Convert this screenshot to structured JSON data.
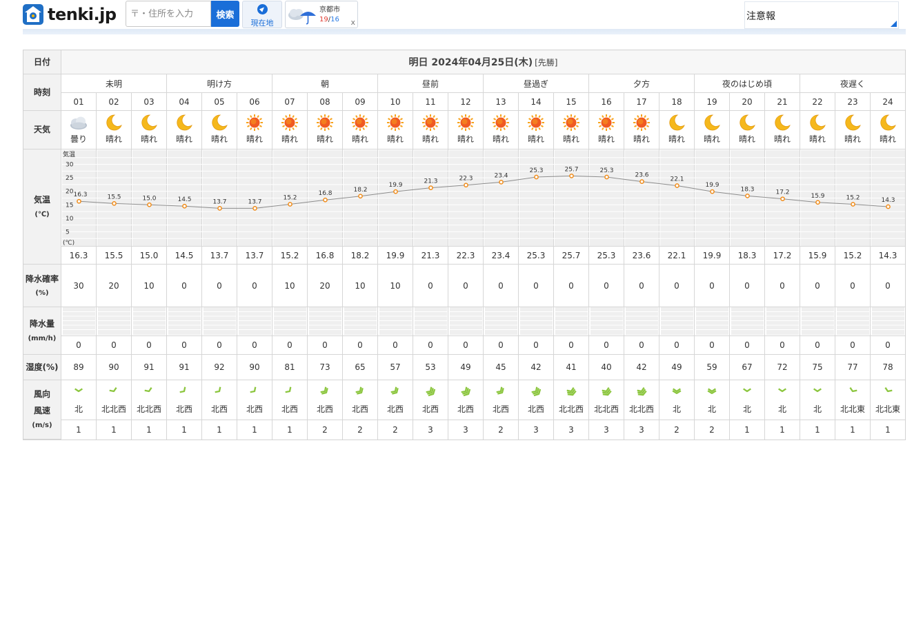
{
  "header": {
    "logo_text": "tenki.jp",
    "search_placeholder": "〒・住所を入力",
    "search_button": "検索",
    "location_button": "現在地",
    "recent": {
      "city": "京都市",
      "high": "19",
      "separator": "/",
      "low": "16",
      "close": "x"
    },
    "alert_label": "注意報"
  },
  "table": {
    "labels": {
      "date": "日付",
      "time": "時刻",
      "weather": "天気",
      "temp": "気温",
      "temp_unit": "(℃)",
      "precip_prob": "降水確率",
      "precip_prob_unit": "(%)",
      "precip_amount": "降水量",
      "precip_amount_unit": "(mm/h)",
      "humidity": "湿度(%)",
      "wind_dir": "風向",
      "wind_speed": "風速",
      "wind_unit": "(m/s)"
    },
    "date_title": "明日 2024年04月25日(木)",
    "date_tag": "[先勝]",
    "periods": [
      "未明",
      "明け方",
      "朝",
      "昼前",
      "昼過ぎ",
      "夕方",
      "夜のはじめ頃",
      "夜遅く"
    ],
    "hours": [
      "01",
      "02",
      "03",
      "04",
      "05",
      "06",
      "07",
      "08",
      "09",
      "10",
      "11",
      "12",
      "13",
      "14",
      "15",
      "16",
      "17",
      "18",
      "19",
      "20",
      "21",
      "22",
      "23",
      "24"
    ],
    "weather": [
      "曇り",
      "晴れ",
      "晴れ",
      "晴れ",
      "晴れ",
      "晴れ",
      "晴れ",
      "晴れ",
      "晴れ",
      "晴れ",
      "晴れ",
      "晴れ",
      "晴れ",
      "晴れ",
      "晴れ",
      "晴れ",
      "晴れ",
      "晴れ",
      "晴れ",
      "晴れ",
      "晴れ",
      "晴れ",
      "晴れ",
      "晴れ"
    ],
    "weather_icons": [
      "cloud-icon",
      "moon-icon",
      "moon-icon",
      "moon-icon",
      "moon-icon",
      "sun-icon",
      "sun-icon",
      "sun-icon",
      "sun-icon",
      "sun-icon",
      "sun-icon",
      "sun-icon",
      "sun-icon",
      "sun-icon",
      "sun-icon",
      "sun-icon",
      "sun-icon",
      "moon-icon",
      "moon-icon",
      "moon-icon",
      "moon-icon",
      "moon-icon",
      "moon-icon",
      "moon-icon"
    ],
    "temps": [
      "16.3",
      "15.5",
      "15.0",
      "14.5",
      "13.7",
      "13.7",
      "15.2",
      "16.8",
      "18.2",
      "19.9",
      "21.3",
      "22.3",
      "23.4",
      "25.3",
      "25.7",
      "25.3",
      "23.6",
      "22.1",
      "19.9",
      "18.3",
      "17.2",
      "15.9",
      "15.2",
      "14.3"
    ],
    "precip_prob": [
      "30",
      "20",
      "10",
      "0",
      "0",
      "0",
      "10",
      "20",
      "10",
      "10",
      "0",
      "0",
      "0",
      "0",
      "0",
      "0",
      "0",
      "0",
      "0",
      "0",
      "0",
      "0",
      "0",
      "0"
    ],
    "precip_amount": [
      "0",
      "0",
      "0",
      "0",
      "0",
      "0",
      "0",
      "0",
      "0",
      "0",
      "0",
      "0",
      "0",
      "0",
      "0",
      "0",
      "0",
      "0",
      "0",
      "0",
      "0",
      "0",
      "0",
      "0"
    ],
    "humidity": [
      "89",
      "90",
      "91",
      "91",
      "92",
      "90",
      "81",
      "73",
      "65",
      "57",
      "53",
      "49",
      "45",
      "42",
      "41",
      "40",
      "42",
      "49",
      "59",
      "67",
      "72",
      "75",
      "77",
      "78"
    ],
    "wind_dir": [
      "北",
      "北北西",
      "北北西",
      "北西",
      "北西",
      "北西",
      "北西",
      "北西",
      "北西",
      "北西",
      "北西",
      "北西",
      "北西",
      "北西",
      "北北西",
      "北北西",
      "北北西",
      "北",
      "北",
      "北",
      "北",
      "北",
      "北北東",
      "北北東"
    ],
    "wind_speed": [
      "1",
      "1",
      "1",
      "1",
      "1",
      "1",
      "1",
      "2",
      "2",
      "2",
      "3",
      "3",
      "2",
      "3",
      "3",
      "3",
      "3",
      "2",
      "2",
      "1",
      "1",
      "1",
      "1",
      "1"
    ],
    "wind_icon": "wind-arrow-icon"
  },
  "chart_data": {
    "type": "line",
    "x": [
      "01",
      "02",
      "03",
      "04",
      "05",
      "06",
      "07",
      "08",
      "09",
      "10",
      "11",
      "12",
      "13",
      "14",
      "15",
      "16",
      "17",
      "18",
      "19",
      "20",
      "21",
      "22",
      "23",
      "24"
    ],
    "series": [
      {
        "values": [
          16.3,
          15.5,
          15.0,
          14.5,
          13.7,
          13.7,
          15.2,
          16.8,
          18.2,
          19.9,
          21.3,
          22.3,
          23.4,
          25.3,
          25.7,
          25.3,
          23.6,
          22.1,
          19.9,
          18.3,
          17.2,
          15.9,
          15.2,
          14.3
        ]
      }
    ],
    "ylabel": "気温",
    "yunit": "(℃)",
    "ylim": [
      0,
      35
    ],
    "yticks": [
      5,
      10,
      15,
      20,
      25,
      30
    ],
    "grid": true,
    "line_color": "#8c8c8c",
    "marker_color": "#f08c1a"
  },
  "colors": {
    "label_bg": "#f2f2f2",
    "border": "#d6d6d6",
    "accent": "#1a6ed8",
    "chart_cell_bg": "#efefef",
    "wind_icon": "#8cc63f"
  }
}
